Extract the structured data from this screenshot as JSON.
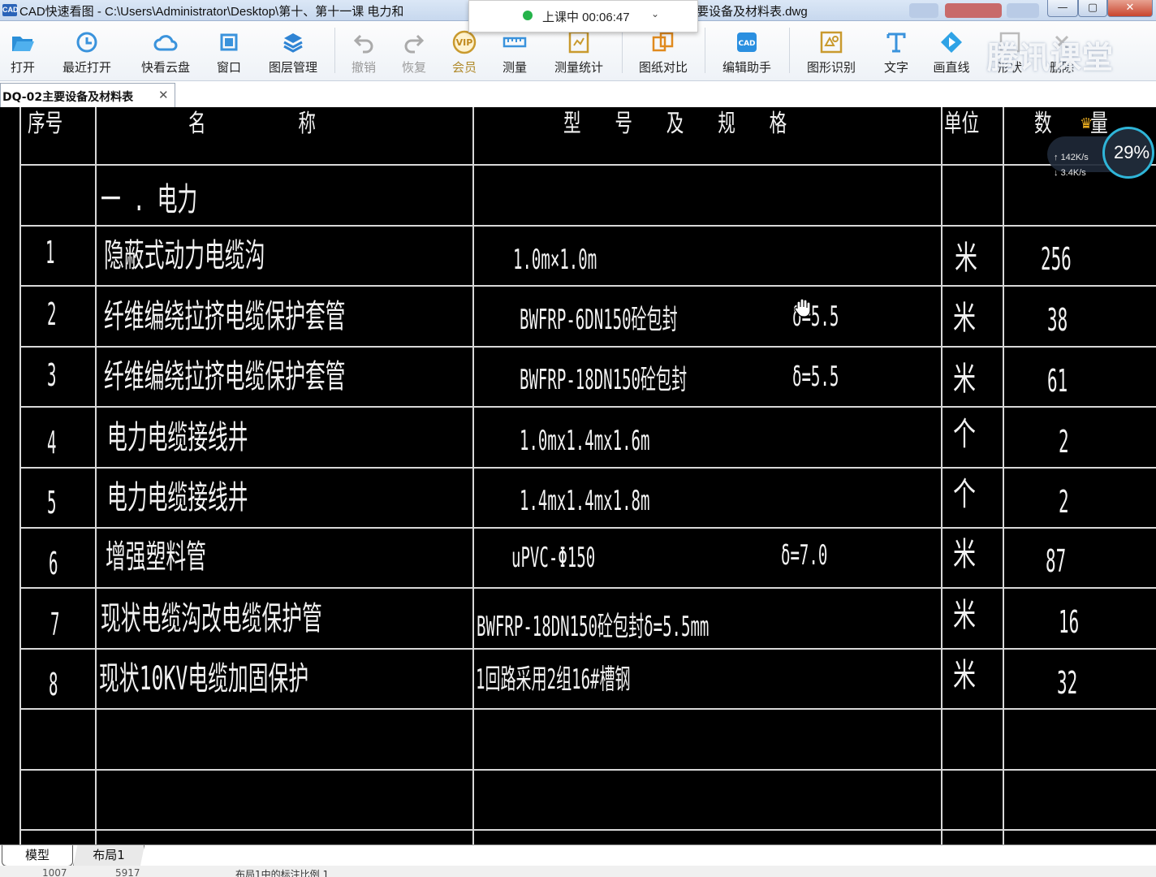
{
  "window": {
    "app_badge": "CAD",
    "title_left": "CAD快速看图 - C:\\Users\\Administrator\\Desktop\\第十、第十一课 电力和",
    "title_right": "要设备及材料表.dwg",
    "minimize": "—",
    "maximize": "▢",
    "close": "✕"
  },
  "live_popup": {
    "status": "上课中 00:06:47",
    "chevron": "⌄"
  },
  "toolbar": {
    "items": [
      {
        "label": "打开",
        "icon": "folder-open-icon"
      },
      {
        "label": "最近打开",
        "icon": "history-icon"
      },
      {
        "label": "快看云盘",
        "icon": "cloud-icon"
      },
      {
        "label": "窗口",
        "icon": "window-icon"
      },
      {
        "label": "图层管理",
        "icon": "layers-icon"
      },
      {
        "label": "撤销",
        "icon": "undo-icon"
      },
      {
        "label": "恢复",
        "icon": "redo-icon"
      },
      {
        "label": "会员",
        "icon": "vip-icon"
      },
      {
        "label": "测量",
        "icon": "ruler-icon"
      },
      {
        "label": "测量统计",
        "icon": "measure-stats-icon"
      },
      {
        "label": "图纸对比",
        "icon": "compare-icon"
      },
      {
        "label": "编辑助手",
        "icon": "cad-edit-icon"
      },
      {
        "label": "图形识别",
        "icon": "shape-recognize-icon"
      },
      {
        "label": "文字",
        "icon": "text-icon"
      },
      {
        "label": "画直线",
        "icon": "line-icon"
      },
      {
        "label": "形状",
        "icon": "shape-icon"
      },
      {
        "label": "删除",
        "icon": "delete-icon"
      }
    ],
    "watermark": "腾讯课堂"
  },
  "doc_tab": {
    "label": "DQ-02主要设备及材料表",
    "close": "✕"
  },
  "table": {
    "headers": {
      "seq": "序号",
      "name": "名 称",
      "spec": "型 号 及 规 格",
      "unit": "单位",
      "qty": "数 量"
    },
    "section": "一 . 电力",
    "rows": [
      {
        "seq": "1",
        "name": "隐蔽式动力电缆沟",
        "spec": "1.0m×1.0m",
        "extra": "",
        "unit": "米",
        "qty": "256"
      },
      {
        "seq": "2",
        "name": "纤维编绕拉挤电缆保护套管",
        "spec": "BWFRP-6DN150砼包封",
        "extra": "δ=5.5",
        "unit": "米",
        "qty": "38"
      },
      {
        "seq": "3",
        "name": "纤维编绕拉挤电缆保护套管",
        "spec": "BWFRP-18DN150砼包封",
        "extra": "δ=5.5",
        "unit": "米",
        "qty": "61"
      },
      {
        "seq": "4",
        "name": "电力电缆接线井",
        "spec": "1.0mx1.4mx1.6m",
        "extra": "",
        "unit": "个",
        "qty": "2"
      },
      {
        "seq": "5",
        "name": "电力电缆接线井",
        "spec": "1.4mx1.4mx1.8m",
        "extra": "",
        "unit": "个",
        "qty": "2"
      },
      {
        "seq": "6",
        "name": "增强塑料管",
        "spec": "uPVC-Φ150",
        "extra": "δ=7.0",
        "unit": "米",
        "qty": "87"
      },
      {
        "seq": "7",
        "name": "现状电缆沟改电缆保护管",
        "spec": "BWFRP-18DN150砼包封δ=5.5mm",
        "extra": "",
        "unit": "米",
        "qty": "16"
      },
      {
        "seq": "8",
        "name": "现状10KV电缆加固保护",
        "spec": "1回路采用2组16#槽钢",
        "extra": "",
        "unit": "米",
        "qty": "32"
      }
    ]
  },
  "net_widget": {
    "up": "142K/s",
    "down": "3.4K/s",
    "percent": "29%"
  },
  "bottom_tabs": {
    "model": "模型",
    "layout": "布局1"
  },
  "status": {
    "text": "布局1中的标注比例 1",
    "coord_x": "1007",
    "coord_y": "5917"
  }
}
